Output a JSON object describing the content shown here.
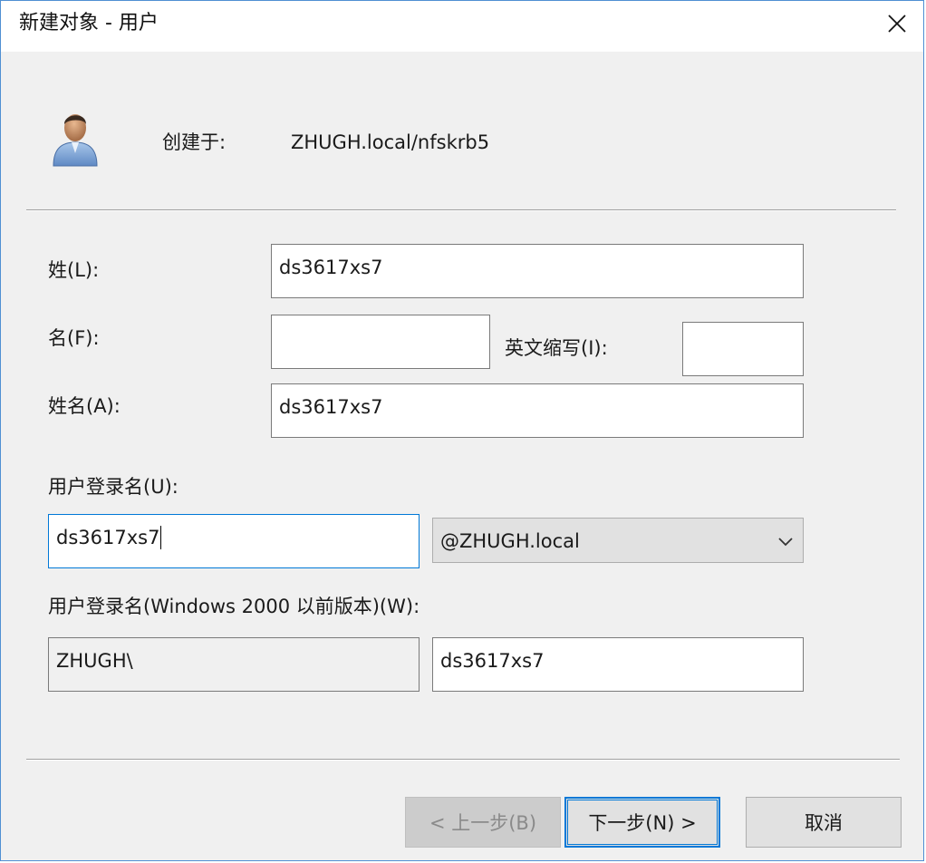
{
  "window": {
    "title": "新建对象 - 用户"
  },
  "header": {
    "created_in_label": "创建于:",
    "created_in_value": "ZHUGH.local/nfskrb5",
    "icon": "user-icon"
  },
  "form": {
    "last_name_label": "姓(L):",
    "last_name_value": "ds3617xs7",
    "first_name_label": "名(F):",
    "first_name_value": "",
    "initials_label": "英文缩写(I):",
    "initials_value": "",
    "full_name_label": "姓名(A):",
    "full_name_value": "ds3617xs7",
    "logon_name_label": "用户登录名(U):",
    "logon_name_value": "ds3617xs7",
    "upn_suffix_selected": "@ZHUGH.local",
    "pre2000_label": "用户登录名(Windows 2000 以前版本)(W):",
    "pre2000_domain_value": "ZHUGH\\",
    "pre2000_name_value": "ds3617xs7"
  },
  "buttons": {
    "back_label": "< 上一步(B)",
    "next_label": "下一步(N) >",
    "cancel_label": "取消"
  },
  "colors": {
    "accent": "#0078d7",
    "window_border": "#4f8fd3",
    "dialog_background": "#f0f0f0"
  }
}
